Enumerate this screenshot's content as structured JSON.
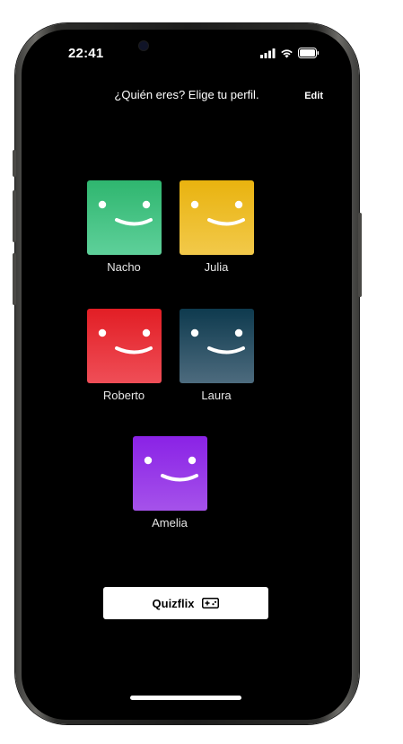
{
  "status_bar": {
    "time": "22:41",
    "icons": [
      "signal-icon",
      "wifi-icon",
      "battery-icon"
    ]
  },
  "header": {
    "title": "¿Quién eres? Elige tu perfil.",
    "edit_label": "Edit"
  },
  "profiles": [
    {
      "name": "Nacho",
      "color_top": "#2fb66f",
      "color_bottom": "#5ed09a"
    },
    {
      "name": "Julia",
      "color_top": "#e9b30f",
      "color_bottom": "#f2c94a"
    },
    {
      "name": "Roberto",
      "color_top": "#e21e25",
      "color_bottom": "#ef4e57"
    },
    {
      "name": "Laura",
      "color_top": "#0e3a4e",
      "color_bottom": "#4d6b7e"
    },
    {
      "name": "Amelia",
      "color_top": "#8a22e6",
      "color_bottom": "#a552ea"
    }
  ],
  "quizflix": {
    "label": "Quizflix",
    "icon": "gamepad-icon"
  }
}
